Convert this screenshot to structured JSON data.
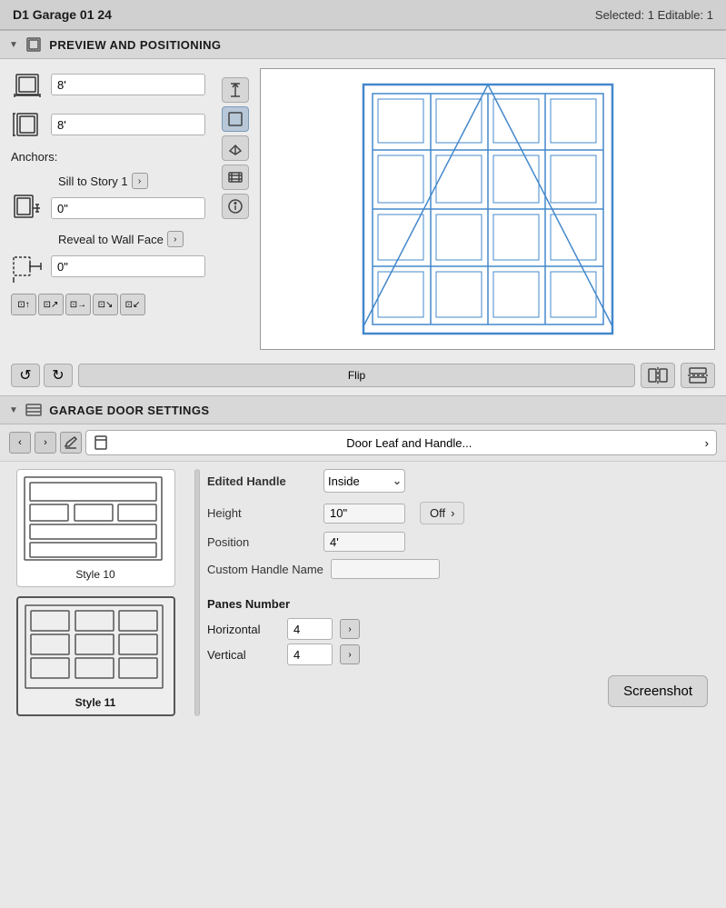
{
  "titleBar": {
    "left": "D1 Garage 01 24",
    "right": "Selected: 1 Editable: 1"
  },
  "previewSection": {
    "header": "PREVIEW AND POSITIONING",
    "widthValue": "8'",
    "heightValue": "8'",
    "anchorsLabel": "Anchors:",
    "sillLabel": "Sill to Story 1",
    "sillValue": "0\"",
    "revealLabel": "Reveal to Wall Face",
    "revealValue": "0\"",
    "flipLabel": "Flip"
  },
  "garageSection": {
    "header": "GARAGE DOOR SETTINGS",
    "doorLeafLabel": "Door Leaf and Handle...",
    "editedHandleLabel": "Edited Handle",
    "editedHandleValue": "Inside",
    "heightLabel": "Height",
    "heightValue": "10\"",
    "positionLabel": "Position",
    "positionValue": "4'",
    "customHandleLabel": "Custom Handle Name",
    "customHandleValue": "",
    "offLabel": "Off",
    "screenshotLabel": "Screenshot",
    "panesTitle": "Panes Number",
    "horizontalLabel": "Horizontal",
    "horizontalValue": "4",
    "verticalLabel": "Vertical",
    "verticalValue": "4",
    "styles": [
      {
        "id": "style10",
        "label": "Style 10",
        "selected": false
      },
      {
        "id": "style11",
        "label": "Style 11",
        "selected": true
      }
    ]
  }
}
